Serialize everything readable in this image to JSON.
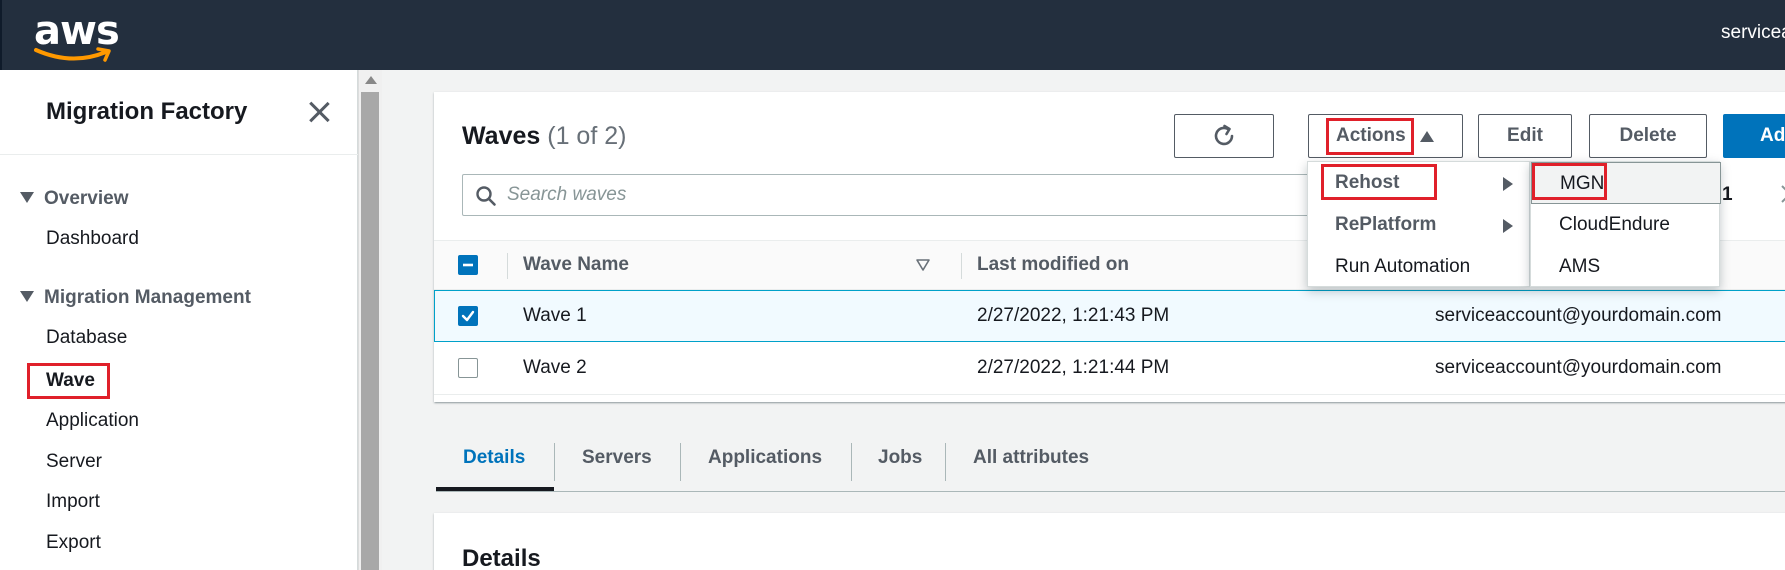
{
  "topbar": {
    "logo_text": "aws",
    "account": "serviceaccount@yourdomain.com"
  },
  "sidebar": {
    "title": "Migration Factory",
    "sections": [
      {
        "label": "Overview",
        "items": [
          "Dashboard"
        ]
      },
      {
        "label": "Migration Management",
        "items": [
          "Database",
          "Wave",
          "Application",
          "Server",
          "Import",
          "Export"
        ]
      }
    ],
    "active_item": "Wave"
  },
  "panel": {
    "title": "Waves",
    "count": "(1 of 2)",
    "buttons": {
      "actions": "Actions",
      "edit": "Edit",
      "delete": "Delete",
      "add": "Add"
    },
    "search": {
      "placeholder": "Search waves"
    },
    "pager": {
      "current": "1"
    }
  },
  "table": {
    "columns": [
      "Wave Name",
      "Last modified on"
    ],
    "rows": [
      {
        "name": "Wave 1",
        "modified": "2/27/2022, 1:21:43 PM",
        "user": "serviceaccount@yourdomain.com",
        "checked": true
      },
      {
        "name": "Wave 2",
        "modified": "2/27/2022, 1:21:44 PM",
        "user": "serviceaccount@yourdomain.com",
        "checked": false
      }
    ]
  },
  "actions_menu": {
    "items": [
      "Rehost",
      "RePlatform",
      "Run Automation"
    ],
    "submenu": [
      "MGN",
      "CloudEndure",
      "AMS"
    ]
  },
  "tabs": [
    "Details",
    "Servers",
    "Applications",
    "Jobs",
    "All attributes"
  ],
  "details": {
    "title": "Details"
  },
  "colors": {
    "accent": "#0073bb",
    "topbar": "#232f3e",
    "highlight": "#e0202a"
  }
}
